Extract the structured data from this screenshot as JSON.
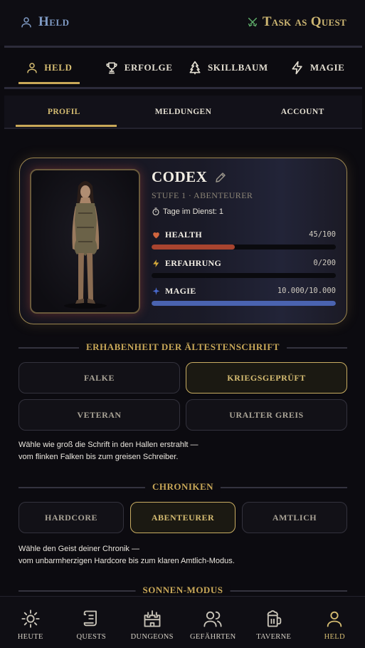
{
  "topbar": {
    "title": "Held",
    "app_name": "Task as Quest",
    "app_icon": "crossed-swords-icon"
  },
  "main_tabs": [
    {
      "label": "HELD",
      "icon": "user-icon",
      "active": true
    },
    {
      "label": "ERFOLGE",
      "icon": "trophy-icon",
      "active": false
    },
    {
      "label": "SKILLBAUM",
      "icon": "tree-icon",
      "active": false
    },
    {
      "label": "MAGIE",
      "icon": "lightning-icon",
      "active": false
    }
  ],
  "sub_tabs": [
    {
      "label": "PROFIL",
      "active": true
    },
    {
      "label": "MELDUNGEN",
      "active": false
    },
    {
      "label": "ACCOUNT",
      "active": false
    }
  ],
  "hero": {
    "name": "CODEX",
    "level": "STUFE 1 · ABENTEURER",
    "days": "Tage im Dienst: 1",
    "stats": {
      "health": {
        "label": "HEALTH",
        "value": "45/100",
        "fraction": 0.45,
        "color": "#a8442f",
        "icon": "heart-icon"
      },
      "xp": {
        "label": "ERFAHRUNG",
        "value": "0/200",
        "fraction": 0.0,
        "color": "#d4a93a",
        "icon": "lightning-icon"
      },
      "magic": {
        "label": "MAGIE",
        "value": "10.000/10.000",
        "fraction": 1.0,
        "color": "#4a63b0",
        "icon": "sparkle-icon"
      }
    }
  },
  "font_section": {
    "title": "ERHABENHEIT DER ÄLTESTENSCHRIFT",
    "options": [
      {
        "label": "FALKE",
        "selected": false
      },
      {
        "label": "KRIEGSGEPRÜFT",
        "selected": true
      },
      {
        "label": "VETERAN",
        "selected": false
      },
      {
        "label": "URALTER GREIS",
        "selected": false
      }
    ],
    "desc_line1": "Wähle wie groß die Schrift in den Hallen erstrahlt —",
    "desc_line2": "vom flinken Falken bis zum greisen Schreiber."
  },
  "chronicle_section": {
    "title": "CHRONIKEN",
    "options": [
      {
        "label": "HARDCORE",
        "selected": false
      },
      {
        "label": "ABENTEURER",
        "selected": true
      },
      {
        "label": "AMTLICH",
        "selected": false
      }
    ],
    "desc_line1": "Wähle den Geist deiner Chronik —",
    "desc_line2": "vom unbarmherzigen Hardcore bis zum klaren Amtlich-Modus."
  },
  "sun_section": {
    "title": "SONNEN-MODUS"
  },
  "bottom_nav": [
    {
      "label": "HEUTE",
      "icon": "sun-icon",
      "active": false
    },
    {
      "label": "QUESTS",
      "icon": "scroll-icon",
      "active": false
    },
    {
      "label": "DUNGEONS",
      "icon": "castle-icon",
      "active": false
    },
    {
      "label": "GEFÄHRTEN",
      "icon": "users-icon",
      "active": false
    },
    {
      "label": "TAVERNE",
      "icon": "beer-mug-icon",
      "active": false
    },
    {
      "label": "HELD",
      "icon": "user-icon",
      "active": true
    }
  ],
  "colors": {
    "accent_gold": "#c9a858",
    "background": "#0c0b10",
    "header_blue": "#7f9ac4"
  }
}
